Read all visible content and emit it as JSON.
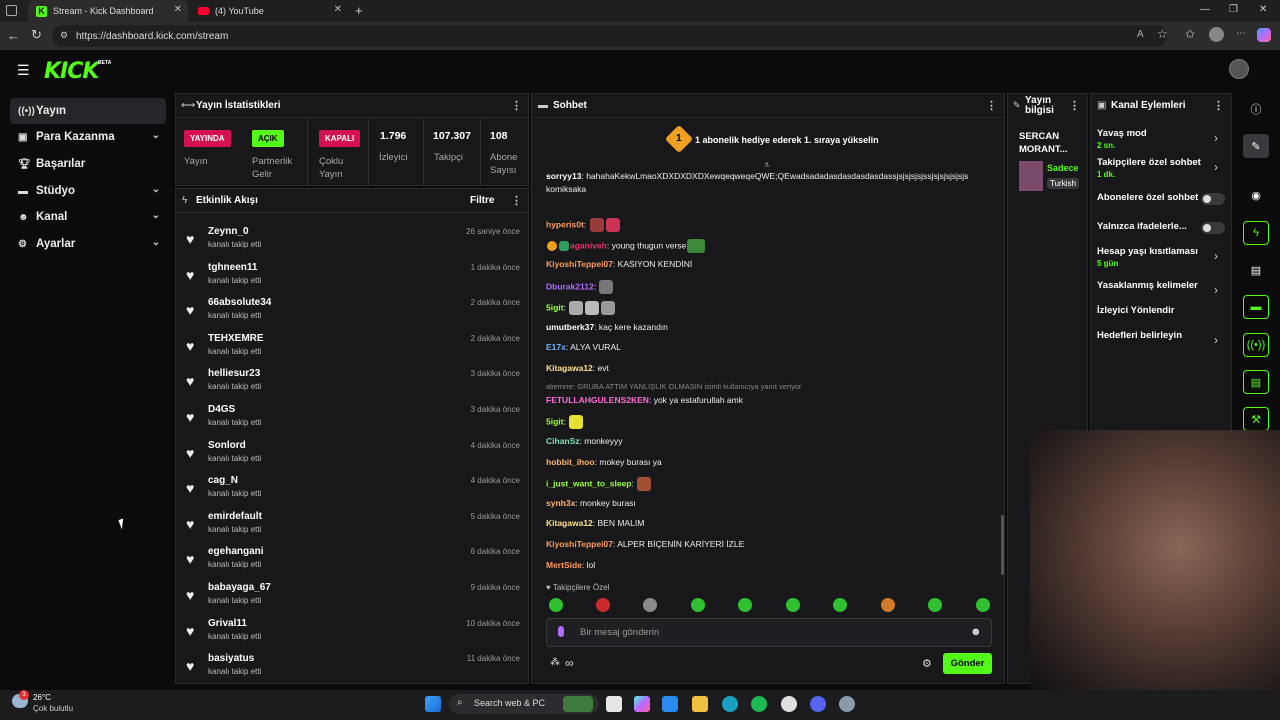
{
  "browser": {
    "tabs": [
      {
        "title": "Stream - Kick Dashboard",
        "active": true
      },
      {
        "title": "(4) YouTube",
        "active": false
      }
    ],
    "url": "https://dashboard.kick.com/stream"
  },
  "app": {
    "logo": "KICK",
    "beta": "BETA"
  },
  "sidebar": {
    "items": [
      {
        "label": "Yayın",
        "icon": "broadcast-icon",
        "active": true,
        "expand": false
      },
      {
        "label": "Para Kazanma",
        "icon": "money-icon",
        "expand": true
      },
      {
        "label": "Başarılar",
        "icon": "trophy-icon",
        "expand": false
      },
      {
        "label": "Stüdyo",
        "icon": "studio-icon",
        "expand": true
      },
      {
        "label": "Kanal",
        "icon": "user-icon",
        "expand": true
      },
      {
        "label": "Ayarlar",
        "icon": "gear-icon",
        "expand": true
      }
    ]
  },
  "stats": {
    "title": "Yayın İstatistikleri",
    "badges": [
      {
        "badge": "YAYINDA",
        "label": "Yayın",
        "color": "#d4124f"
      },
      {
        "badge": "AÇIK",
        "label": "Partnerlik Gelir",
        "color": "#53fc18"
      },
      {
        "badge": "KAPALI",
        "label": "Çoklu Yayın",
        "color": "#d4124f"
      }
    ],
    "numbers": [
      {
        "value": "1.796",
        "label": "İzleyici"
      },
      {
        "value": "107.307",
        "label": "Takipçi"
      },
      {
        "value": "108",
        "label": "Abone Sayısı"
      }
    ]
  },
  "activity": {
    "title": "Etkinlik Akışı",
    "filter": "Filtre",
    "items": [
      {
        "name": "Zeynn_0",
        "action": "kanalı takip etti",
        "time": "26 saniye önce"
      },
      {
        "name": "tghneen11",
        "action": "kanalı takip etti",
        "time": "1 dakika önce"
      },
      {
        "name": "66absolute34",
        "action": "kanalı takip etti",
        "time": "2 dakika önce"
      },
      {
        "name": "TEHXEMRE",
        "action": "kanalı takip etti",
        "time": "2 dakika önce"
      },
      {
        "name": "helliesur23",
        "action": "kanalı takip etti",
        "time": "3 dakika önce"
      },
      {
        "name": "D4GS",
        "action": "kanalı takip etti",
        "time": "3 dakika önce"
      },
      {
        "name": "Sonlord",
        "action": "kanalı takip etti",
        "time": "4 dakika önce"
      },
      {
        "name": "cag_N",
        "action": "kanalı takip etti",
        "time": "4 dakika önce"
      },
      {
        "name": "emirdefault",
        "action": "kanalı takip etti",
        "time": "5 dakika önce"
      },
      {
        "name": "egehangani",
        "action": "kanalı takip etti",
        "time": "6 dakika önce"
      },
      {
        "name": "babayaga_67",
        "action": "kanalı takip etti",
        "time": "9 dakika önce"
      },
      {
        "name": "Grival11",
        "action": "kanalı takip etti",
        "time": "10 dakika önce"
      },
      {
        "name": "basiyatus",
        "action": "kanalı takip etti",
        "time": "11 dakika önce"
      }
    ]
  },
  "chat": {
    "title": "Sohbet",
    "gift_number": "1",
    "gift_text": "1 abonelik hediye ederek 1. sıraya yükselin",
    "messages": [
      {
        "user": "sorryy13",
        "color": "#ffffff",
        "text": "hahahaKekwLmaoXDXDXDXDXewqeqweqeQWE;QEwadsadadasdasdasdasdassjsjsjsjsjssjsjsjsjsjsjs"
      },
      {
        "user": "",
        "color": "#ffffff",
        "text": "komiksaka"
      },
      {
        "user": "hyperis0t",
        "color": "#ff9a5c",
        "text": ""
      },
      {
        "user": "aganiveh",
        "color": "#e9326b",
        "text": "young thugun verse"
      },
      {
        "user": "KiyoshiTeppei07",
        "color": "#ff9a5c",
        "text": "KASIYON KENDİNİ"
      },
      {
        "user": "Dburak2112",
        "color": "#b36bff",
        "text": ""
      },
      {
        "user": "5igit",
        "color": "#9bff3a",
        "text": ""
      },
      {
        "user": "umutberk37",
        "color": "#ffffff",
        "text": "kaç kere kazandın"
      },
      {
        "user": "E17x",
        "color": "#6fb3ff",
        "text": "ALYA VURAL"
      },
      {
        "user": "Kitagawa12",
        "color": "#ffe08a",
        "text": "evt"
      },
      {
        "user": "FETULLAHGULENS2KEN",
        "color": "#ff6ad5",
        "text": "yok ya estafurullah amk"
      },
      {
        "user": "5igit",
        "color": "#9bff3a",
        "text": ""
      },
      {
        "user": "CihanSz",
        "color": "#7fe3b0",
        "text": "monkeyyy"
      },
      {
        "user": "hobbit_ihoo",
        "color": "#ffb36b",
        "text": "mokey burası ya"
      },
      {
        "user": "i_just_want_to_sleep",
        "color": "#9bff3a",
        "text": ""
      },
      {
        "user": "synh3x",
        "color": "#ffb36b",
        "text": "monkey burası"
      },
      {
        "user": "Kitagawa12",
        "color": "#ffe08a",
        "text": "BEN MALIM"
      },
      {
        "user": "KiyoshiTeppei07",
        "color": "#ff9a5c",
        "text": "ALPER BİÇENİN KARİYERİ İZLE"
      },
      {
        "user": "MertSide",
        "color": "#ff9a5c",
        "text": "lol"
      }
    ],
    "reply_note": "aliemrre: GRUBA ATTIM YANLIŞLIK OLMASIN isimli kullanıcıya yanıt veriyor",
    "followers_only": "Takipçilere Özel",
    "placeholder": "Bir mesaj gönderin",
    "send": "Gönder"
  },
  "broadcast_info": {
    "title": "Yayın bilgisi",
    "streamer": "SERCAN MORANT...",
    "category": "Sadece",
    "language": "Turkish"
  },
  "channel_actions": {
    "title": "Kanal Eylemleri",
    "items": [
      {
        "label": "Yavaş mod",
        "sub": "2 sn.",
        "control": "chevron"
      },
      {
        "label": "Takipçilere özel sohbet",
        "sub": "1 dk.",
        "control": "chevron"
      },
      {
        "label": "Abonelere özel sohbet",
        "sub": "",
        "control": "toggle"
      },
      {
        "label": "Yalnızca ifadelerle...",
        "sub": "",
        "control": "toggle"
      },
      {
        "label": "Hesap yaşı kısıtlaması",
        "sub": "5 gün",
        "control": "chevron"
      },
      {
        "label": "Yasaklanmış kelimeler",
        "sub": "",
        "control": "chevron"
      },
      {
        "label": "İzleyici Yönlendir",
        "sub": "",
        "control": "none"
      },
      {
        "label": "Hedefleri belirleyin",
        "sub": "",
        "control": "chevron"
      }
    ]
  },
  "taskbar": {
    "weather_temp": "26°C",
    "weather_desc": "Çok bulutlu",
    "search": "Search web & PC",
    "weather_badge": "3"
  },
  "colors": {
    "accent": "#53fc18",
    "live": "#d4124f",
    "panel": "#18181b"
  }
}
